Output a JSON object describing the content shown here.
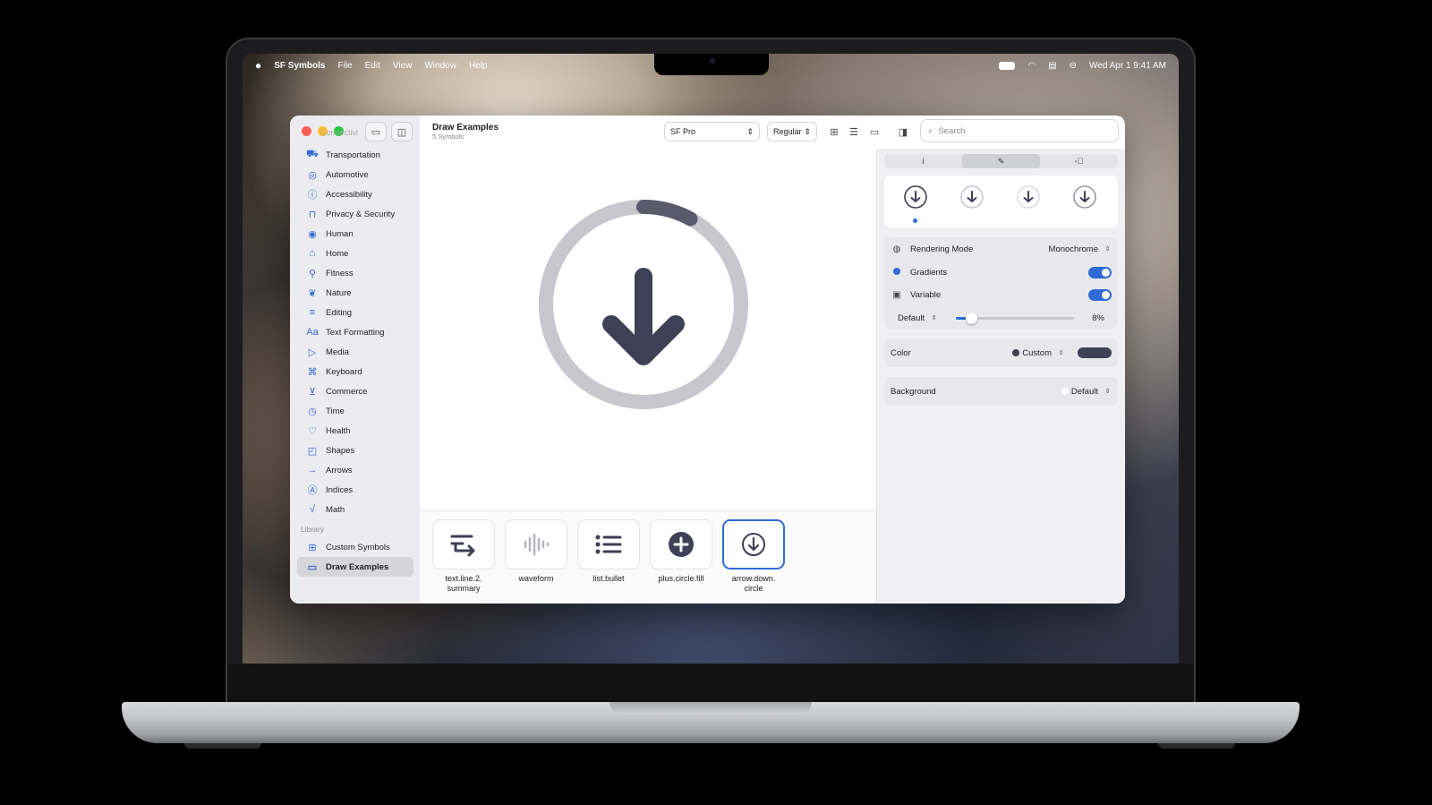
{
  "menubar": {
    "apple": "",
    "app": "SF Symbols",
    "items": [
      "File",
      "Edit",
      "View",
      "Window",
      "Help"
    ],
    "datetime": "Wed Apr 1  9:41 AM"
  },
  "sidebar": {
    "faded_label": "Connectivi",
    "items": [
      {
        "label": "Transportation",
        "icon": "car-icon"
      },
      {
        "label": "Automotive",
        "icon": "steering-wheel-icon"
      },
      {
        "label": "Accessibility",
        "icon": "accessibility-icon"
      },
      {
        "label": "Privacy & Security",
        "icon": "lock-icon"
      },
      {
        "label": "Human",
        "icon": "person-icon"
      },
      {
        "label": "Home",
        "icon": "house-icon"
      },
      {
        "label": "Fitness",
        "icon": "running-figure-icon"
      },
      {
        "label": "Nature",
        "icon": "leaf-icon"
      },
      {
        "label": "Editing",
        "icon": "sliders-icon"
      },
      {
        "label": "Text Formatting",
        "icon": "text-format-icon"
      },
      {
        "label": "Media",
        "icon": "play-pause-icon"
      },
      {
        "label": "Keyboard",
        "icon": "command-icon"
      },
      {
        "label": "Commerce",
        "icon": "cart-icon"
      },
      {
        "label": "Time",
        "icon": "clock-icon"
      },
      {
        "label": "Health",
        "icon": "heart-icon"
      },
      {
        "label": "Shapes",
        "icon": "shapes-icon"
      },
      {
        "label": "Arrows",
        "icon": "arrow-right-icon"
      },
      {
        "label": "Indices",
        "icon": "circle-a-icon"
      },
      {
        "label": "Math",
        "icon": "square-root-icon"
      }
    ],
    "library_heading": "Library",
    "library": [
      {
        "label": "Custom Symbols",
        "icon": "grid-icon"
      },
      {
        "label": "Draw Examples",
        "icon": "folder-icon"
      }
    ]
  },
  "main": {
    "title": "Draw Examples",
    "subtitle": "5 Symbols",
    "font_popup": "SF Pro",
    "weight_popup": "Regular",
    "search_placeholder": "Search",
    "symbols": [
      {
        "label_1": "text.line.2.",
        "label_2": "summary"
      },
      {
        "label_1": "waveform",
        "label_2": ""
      },
      {
        "label_1": "list.bullet",
        "label_2": ""
      },
      {
        "label_1": "plus.circle.fill",
        "label_2": ""
      },
      {
        "label_1": "arrow.down.",
        "label_2": "circle"
      }
    ],
    "progress_fraction": 0.08
  },
  "inspector": {
    "tabs": [
      "i",
      "✎",
      "◦⃝"
    ],
    "rendering_mode_label": "Rendering Mode",
    "rendering_mode_value": "Monochrome",
    "gradients_label": "Gradients",
    "variable_label": "Variable",
    "variable_mode": "Default",
    "variable_percent": "8%",
    "variable_fraction": 0.08,
    "color_label": "Color",
    "color_value": "Custom",
    "background_label": "Background",
    "background_value": "Default",
    "colors": {
      "accent": "#2f6bd6",
      "symbol": "#3f3f55",
      "ring": "#c8c7ce"
    }
  }
}
